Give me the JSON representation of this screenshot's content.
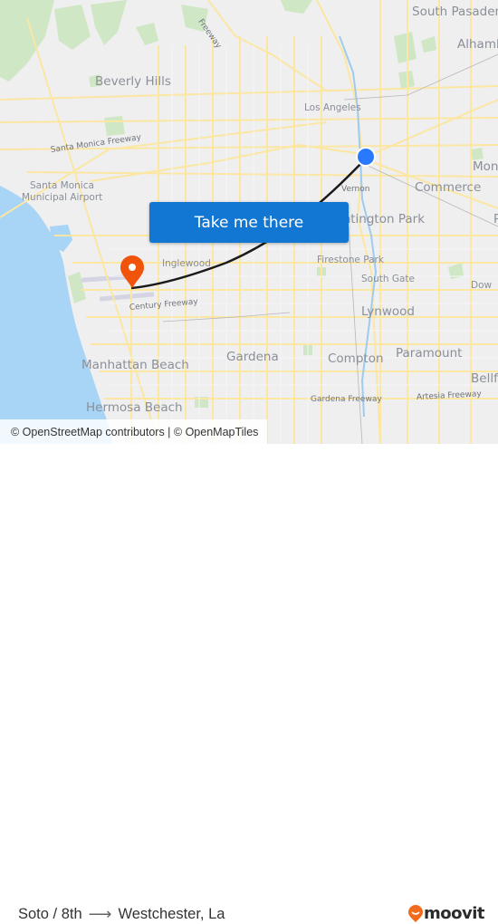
{
  "map": {
    "labels": {
      "south_pasadena": "South Pasadena",
      "alhambra": "Alhambra",
      "beverly_hills": "Beverly Hills",
      "los_angeles": "Los Angeles",
      "santa_monica_freeway": "Santa Monica Freeway",
      "santa_monica_airport_1": "Santa Monica",
      "santa_monica_airport_2": "Municipal Airport",
      "vernon": "Vernon",
      "commerce": "Commerce",
      "monterey_park": "Mon",
      "huntington_park": "Huntington Park",
      "inglewood": "Inglewood",
      "firestone_park": "Firestone Park",
      "south_gate": "South Gate",
      "downey": "Dow",
      "century_freeway": "Century Freeway",
      "lynwood": "Lynwood",
      "paramount": "Paramount",
      "manhattan_beach": "Manhattan Beach",
      "gardena": "Gardena",
      "compton": "Compton",
      "bellflower": "Bellf",
      "hermosa_beach": "Hermosa Beach",
      "gardena_freeway": "Gardena Freeway",
      "artesia_freeway": "Artesia Freeway",
      "glendale_freeway": "Freeway",
      "pico_rivera": "P"
    },
    "origin_marker_color": "#2979ff",
    "destination_marker_color": "#f0530a",
    "route_color": "#1a1a1a"
  },
  "cta": {
    "label": "Take me there"
  },
  "attribution": "© OpenStreetMap contributors | © OpenMapTiles",
  "trip": {
    "origin": "Soto / 8th",
    "arrow": "⟶",
    "destination": "Westchester, La"
  },
  "brand": {
    "name": "moovit",
    "color": "#f26a1b"
  }
}
